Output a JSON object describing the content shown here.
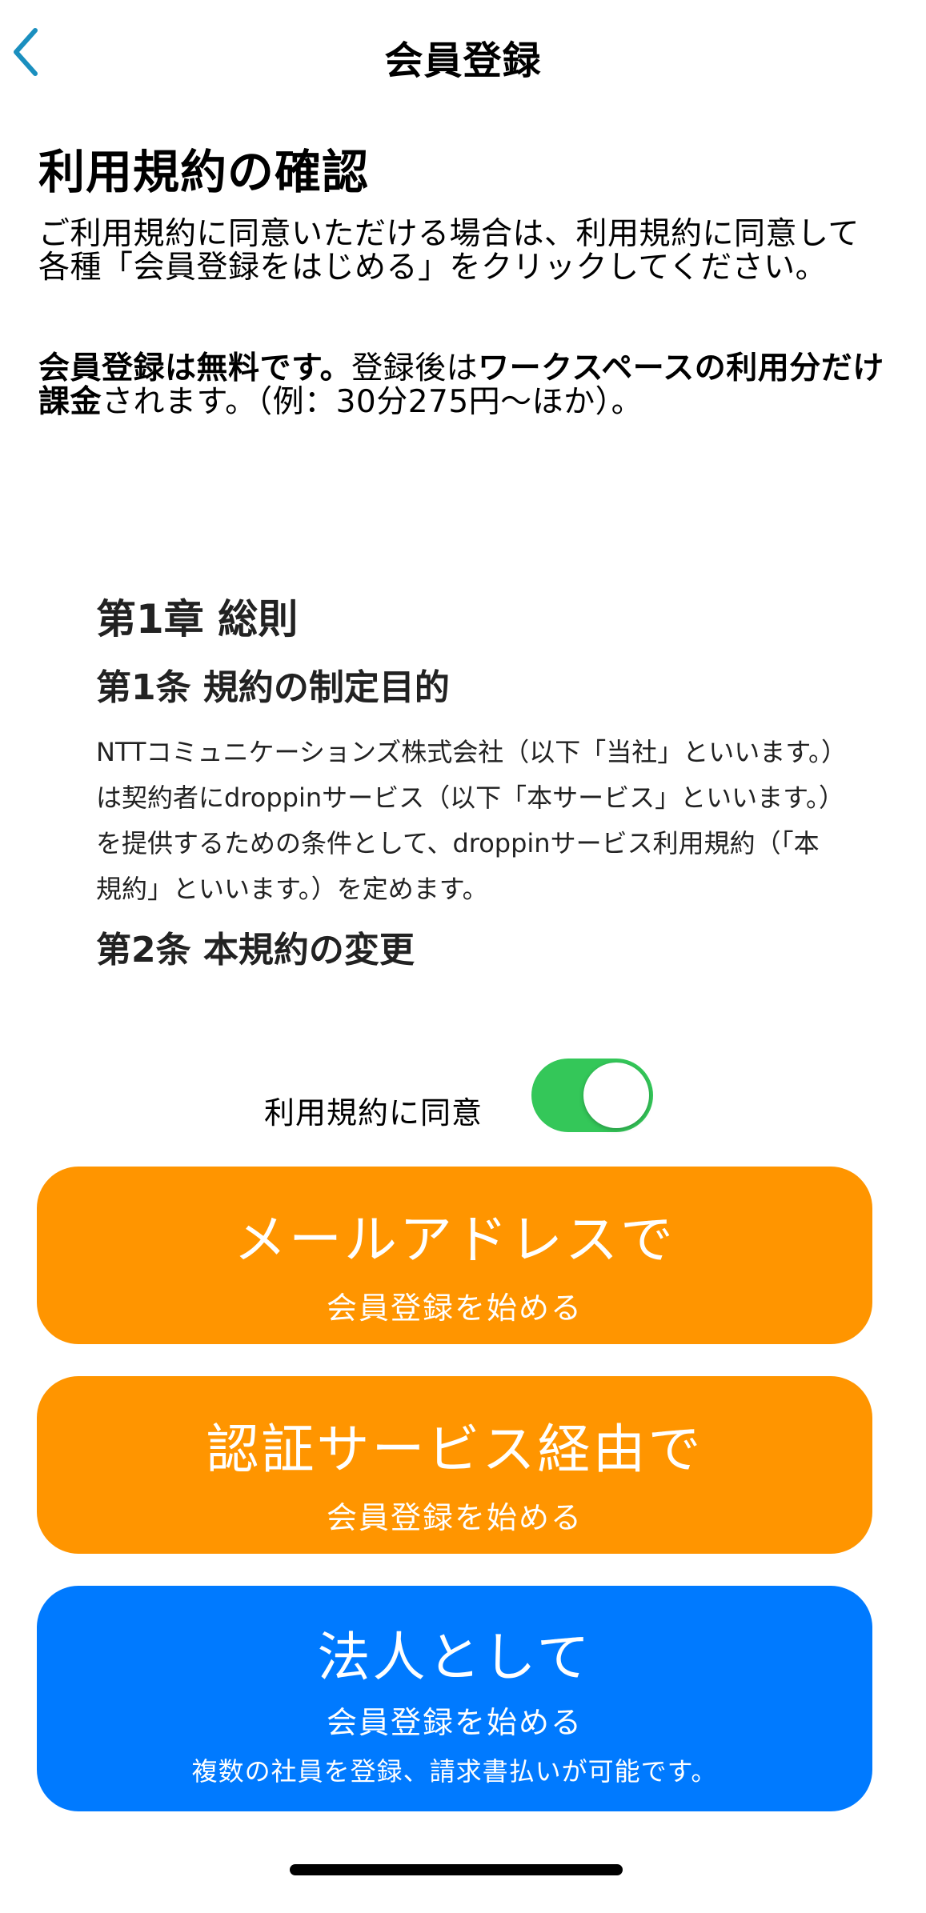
{
  "nav": {
    "title": "会員登録",
    "back_icon": "chevron-left-icon",
    "accent": "#1a8fbf"
  },
  "heading": "利用規約の確認",
  "intro": "ご利用規約に同意いただける場合は、利用規約に同意して各種「会員登録をはじめる」をクリックしてください。",
  "fee": {
    "part1": "会員登録は無料です。",
    "part2": "登録後は",
    "part3": "ワークスペースの利用分だけ課金",
    "part4": "されます。（例：30分275円〜ほか）。"
  },
  "terms": {
    "chapter": "第1章 総則",
    "article1_title": "第1条 規約の制定目的",
    "article1_body": "NTTコミュニケーションズ株式会社（以下「当社」といいます。）は契約者にdroppinサービス（以下「本サービス」といいます。）を提供するための条件として、droppinサービス利用規約（「本規約」といいます。）を定めます。",
    "article2_title": "第2条 本規約の変更"
  },
  "agree": {
    "label": "利用規約に同意",
    "checked": true,
    "color": "#34c759"
  },
  "buttons": {
    "mail": {
      "title": "メールアドレスで",
      "sub": "会員登録を始める",
      "color": "#ff9500"
    },
    "auth": {
      "title": "認証サービス経由で",
      "sub": "会員登録を始める",
      "color": "#ff9500"
    },
    "corp": {
      "title": "法人として",
      "sub": "会員登録を始める",
      "note": "複数の社員を登録、請求書払いが可能です。",
      "color": "#007aff"
    }
  }
}
